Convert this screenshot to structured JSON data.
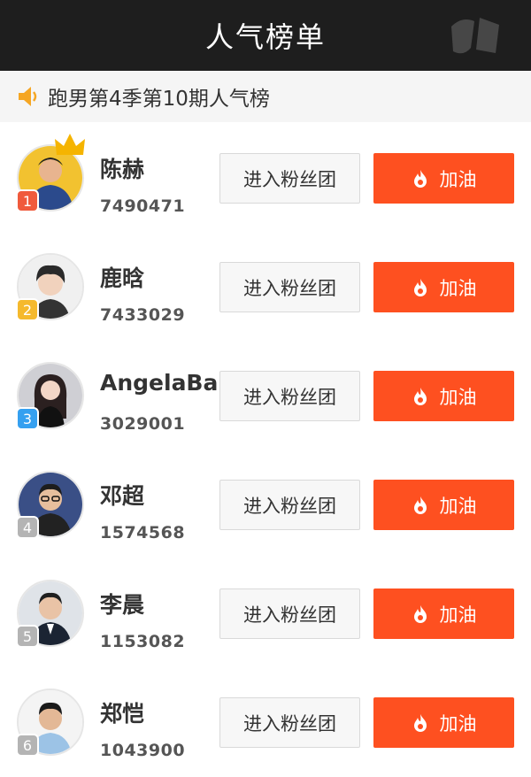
{
  "header": {
    "title": "人气榜单"
  },
  "subtitle": {
    "text": "跑男第4季第10期人气榜",
    "icon": "speaker-icon"
  },
  "colors": {
    "header_bg": "#1e1e1e",
    "accent": "#fe5020",
    "rank_1": "#f05a3c",
    "rank_2": "#f5b92d",
    "rank_3": "#35a0f0",
    "rank_other": "#b4b4b4",
    "crown": "#f5b400"
  },
  "list": {
    "items": [
      {
        "rank": "1",
        "name": "陈赫",
        "score": "7490471",
        "fan_label": "进入粉丝团",
        "cheer_label": "加油",
        "crown": true
      },
      {
        "rank": "2",
        "name": "鹿晗",
        "score": "7433029",
        "fan_label": "进入粉丝团",
        "cheer_label": "加油"
      },
      {
        "rank": "3",
        "name": "AngelaBab",
        "score": "3029001",
        "fan_label": "进入粉丝团",
        "cheer_label": "加油"
      },
      {
        "rank": "4",
        "name": "邓超",
        "score": "1574568",
        "fan_label": "进入粉丝团",
        "cheer_label": "加油"
      },
      {
        "rank": "5",
        "name": "李晨",
        "score": "1153082",
        "fan_label": "进入粉丝团",
        "cheer_label": "加油"
      },
      {
        "rank": "6",
        "name": "郑恺",
        "score": "1043900",
        "fan_label": "进入粉丝团",
        "cheer_label": "加油"
      }
    ]
  }
}
